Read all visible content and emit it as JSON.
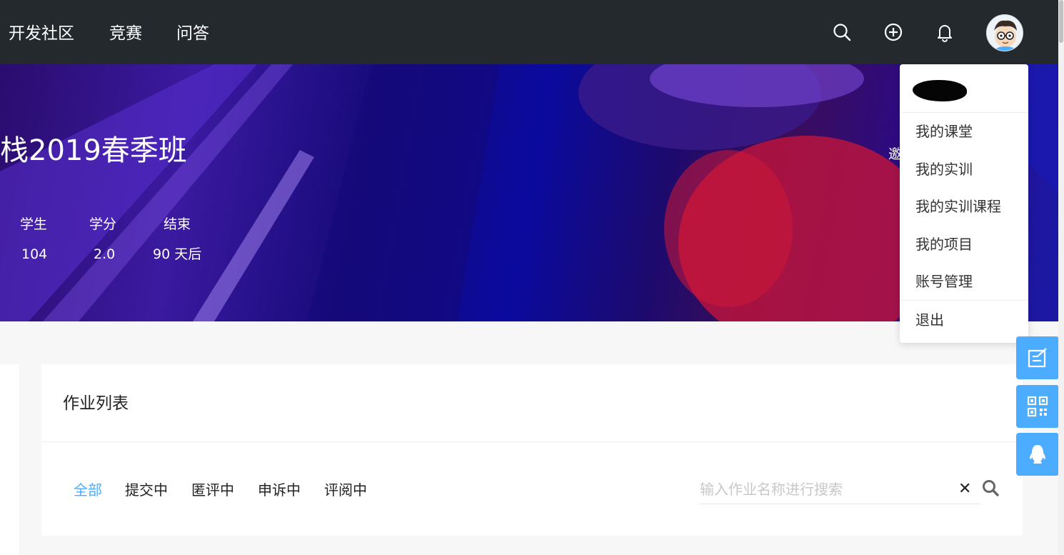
{
  "nav": {
    "items": [
      "开发社区",
      "竞赛",
      "问答"
    ]
  },
  "banner": {
    "course_title": "栈2019春季班",
    "invite_text": "邀",
    "stats": [
      {
        "label": "学生",
        "value": "104"
      },
      {
        "label": "学分",
        "value": "2.0"
      },
      {
        "label": "结束",
        "value": "90 天后"
      }
    ]
  },
  "user_menu": {
    "items": [
      "我的课堂",
      "我的实训",
      "我的实训课程",
      "我的项目",
      "账号管理"
    ],
    "logout": "退出"
  },
  "homework": {
    "title": "作业列表",
    "tabs": [
      "全部",
      "提交中",
      "匿评中",
      "申诉中",
      "评阅中"
    ],
    "active_tab": "全部",
    "search_placeholder": "输入作业名称进行搜索",
    "clear_symbol": "✕"
  },
  "colors": {
    "accent": "#4cacff",
    "topbar": "#24292d"
  }
}
